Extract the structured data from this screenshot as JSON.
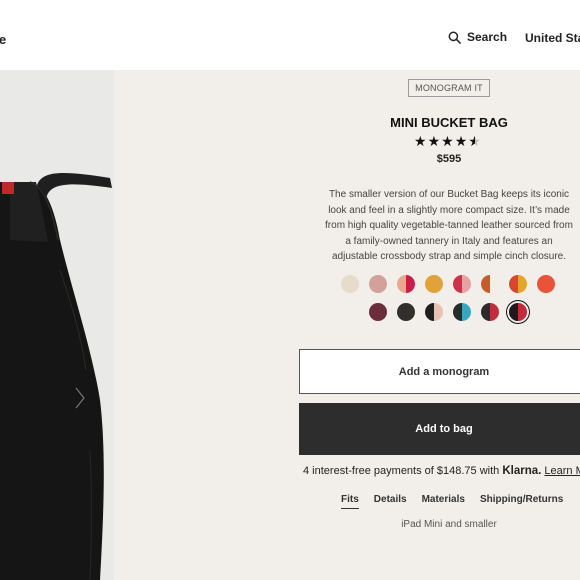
{
  "header": {
    "brand_fragment": "e",
    "search_label": "Search",
    "country": "United Sta"
  },
  "product": {
    "badge": "MONOGRAM IT",
    "title": "MINI BUCKET BAG",
    "rating": 4.5,
    "price": "$595",
    "description": "The smaller version of our Bucket Bag keeps its iconic look and feel in a slightly more compact size. It’s made from high quality vegetable-tanned leather sourced from a family-owned tannery in Italy and features an adjustable crossbody strap and simple cinch closure."
  },
  "swatches": {
    "row1": [
      {
        "left": "#e6dccb",
        "right": "#e6dccb"
      },
      {
        "left": "#d4a19a",
        "right": "#d4a19a"
      },
      {
        "left": "#e9a98f",
        "right": "#c61f4a"
      },
      {
        "left": "#e1a23a",
        "right": "#e1a23a"
      },
      {
        "left": "#c8354a",
        "right": "#e9a2a2"
      },
      {
        "left": "#c65c2c",
        "right": "#f4eee6"
      },
      {
        "left": "#d6492b",
        "right": "#e6a52a"
      },
      {
        "left": "#e8533a",
        "right": "#e8533a"
      }
    ],
    "row2": [
      {
        "left": "#6c2d3b",
        "right": "#6c2d3b"
      },
      {
        "left": "#332f2d",
        "right": "#332f2d"
      },
      {
        "left": "#1f1f1f",
        "right": "#e8c1b0"
      },
      {
        "left": "#2a2a2a",
        "right": "#39a7bf"
      },
      {
        "left": "#2b2b2b",
        "right": "#c12e3b"
      },
      {
        "left": "#1b1b1b",
        "right": "#c42a3a"
      }
    ],
    "selected_index_row2": 5
  },
  "actions": {
    "monogram_label": "Add a monogram",
    "add_to_bag_label": "Add to bag"
  },
  "klarna": {
    "text": "4 interest-free payments of $148.75 with",
    "logo": "Klarna.",
    "learn_more": "Learn Mo"
  },
  "tabs": [
    {
      "label": "Fits",
      "active": true
    },
    {
      "label": "Details",
      "active": false
    },
    {
      "label": "Materials",
      "active": false
    },
    {
      "label": "Shipping/Returns",
      "active": false
    }
  ],
  "tab_content": "iPad Mini and smaller"
}
